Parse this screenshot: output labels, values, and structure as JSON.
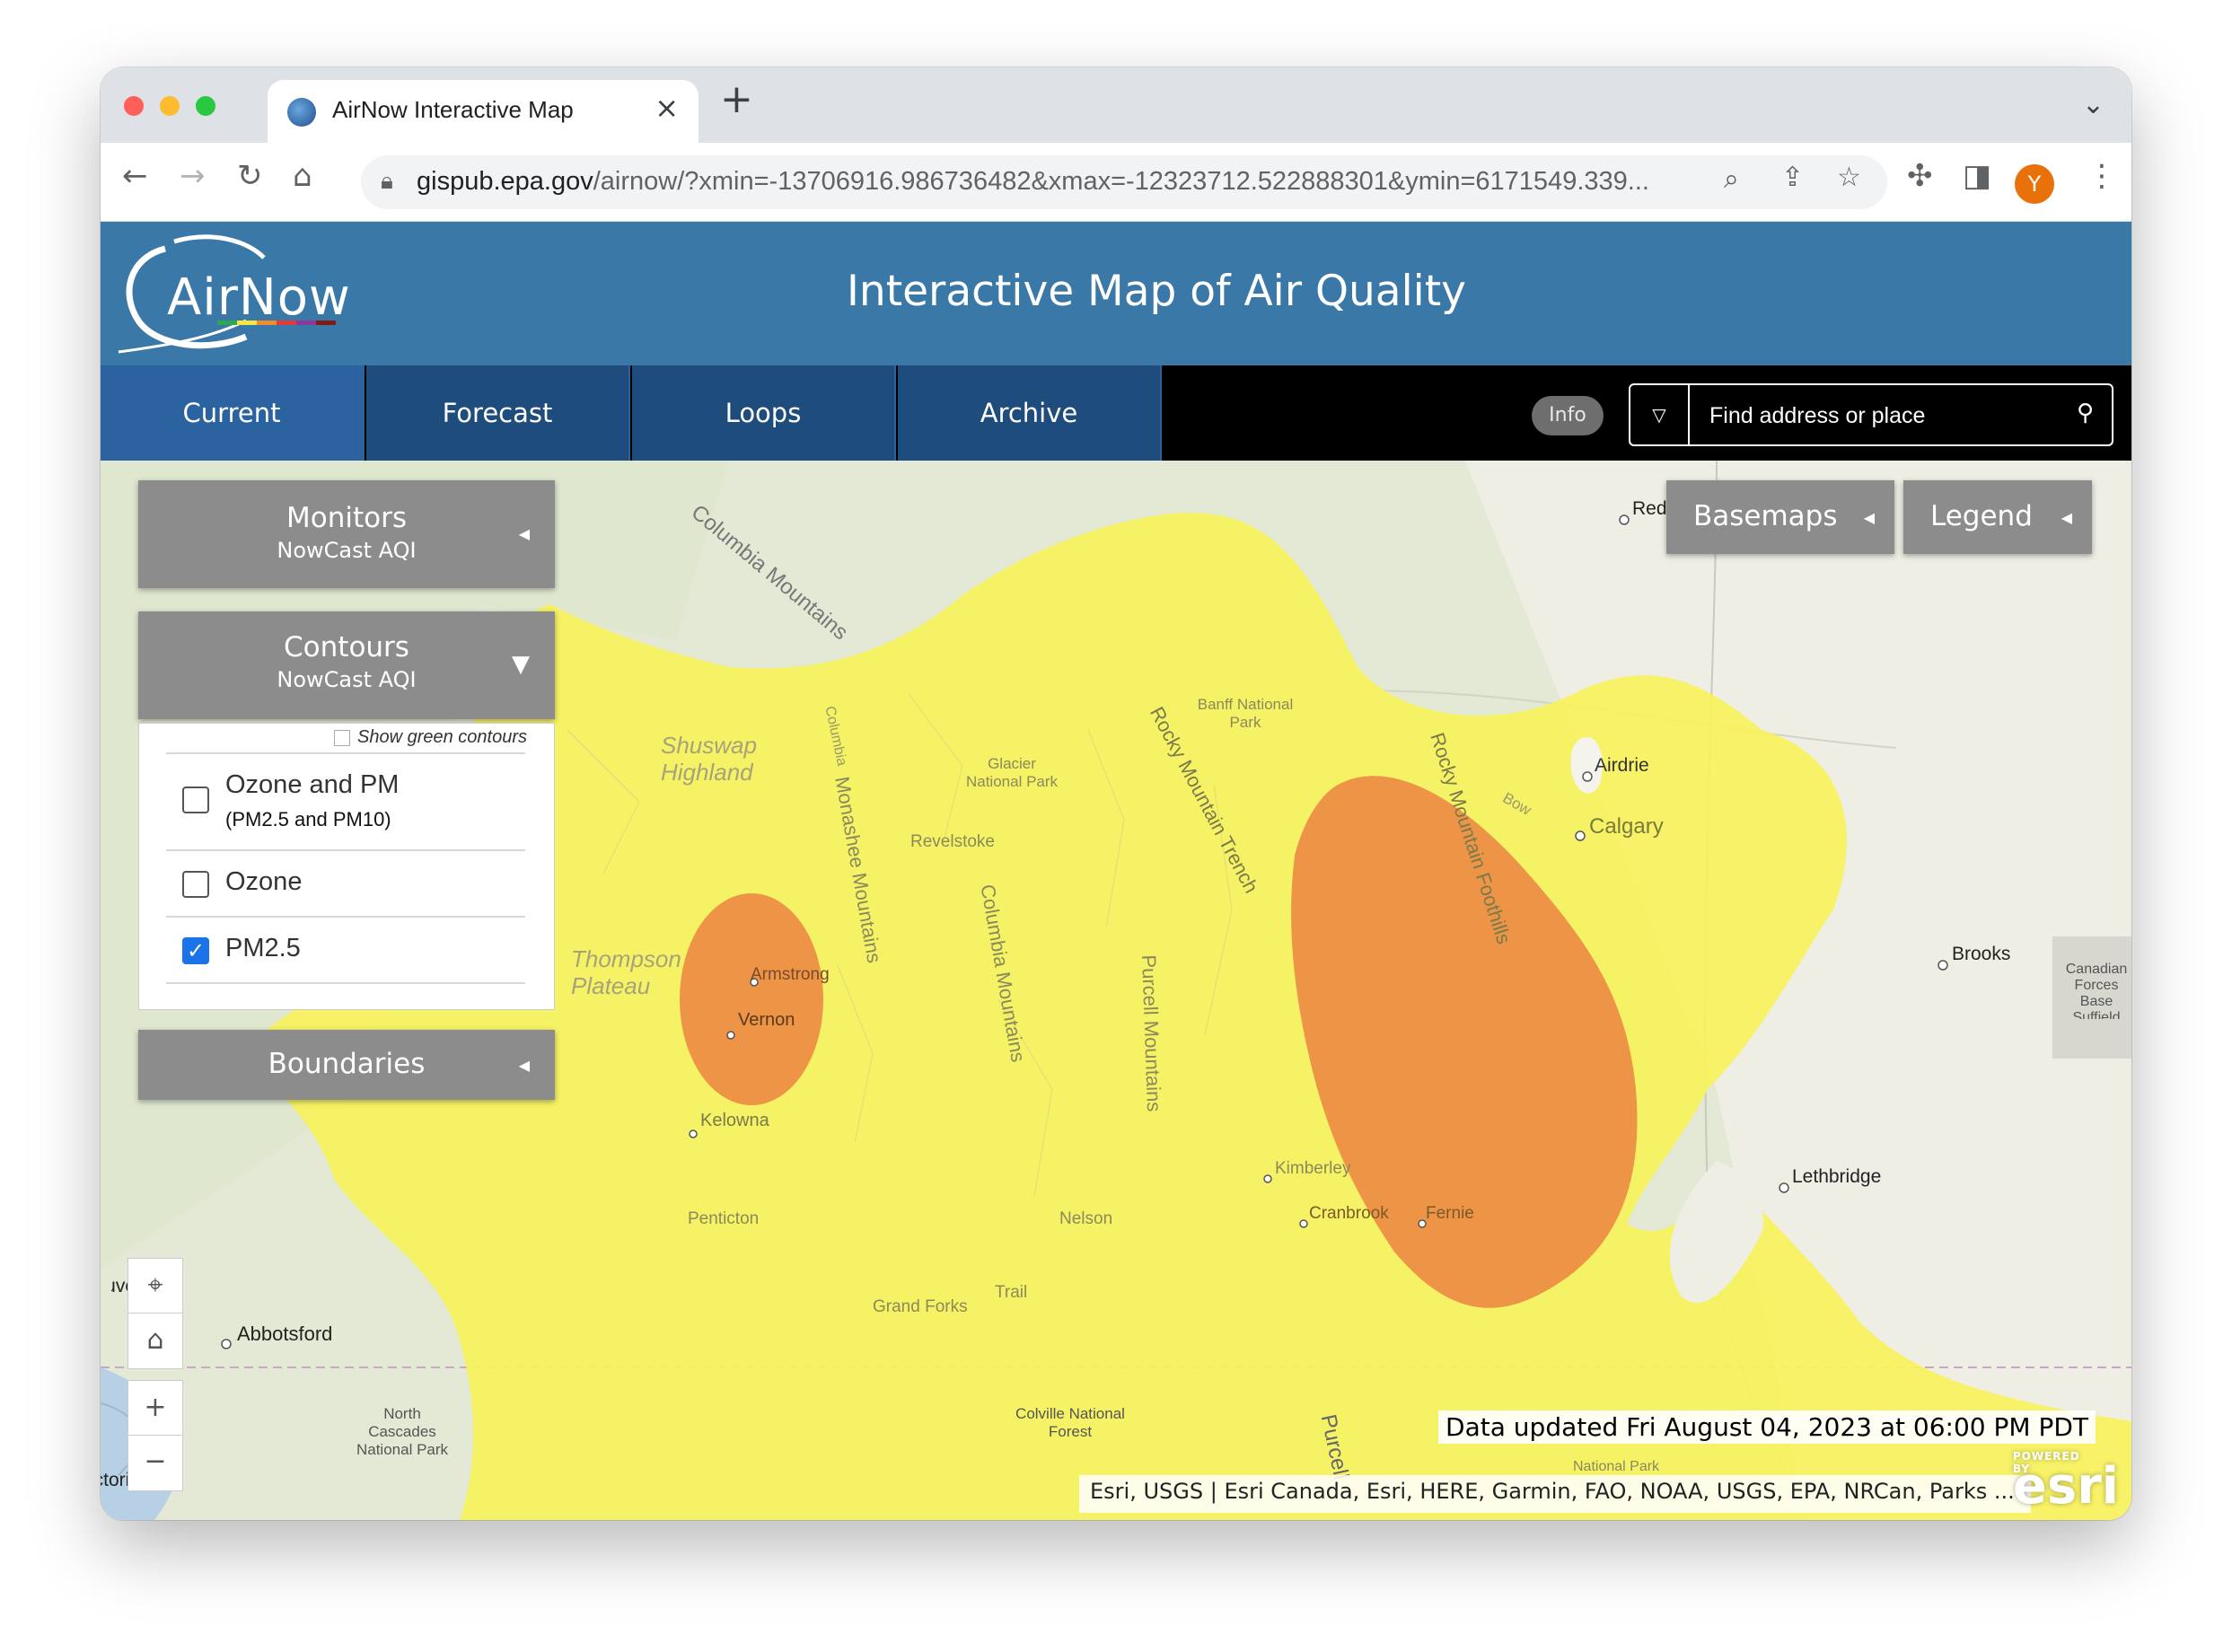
{
  "browser": {
    "tab_title": "AirNow Interactive Map",
    "url_host": "gispub.epa.gov",
    "url_rest": "/airnow/?xmin=-13706916.986736482&xmax=-12323712.522888301&ymin=6171549.339...",
    "avatar_initial": "Y"
  },
  "header": {
    "logo_text": "AirNow",
    "title": "Interactive Map of Air Quality"
  },
  "nav": {
    "tabs": [
      "Current",
      "Forecast",
      "Loops",
      "Archive"
    ],
    "info_label": "Info",
    "search_placeholder": "Find address or place"
  },
  "panels": {
    "monitors": {
      "title": "Monitors",
      "subtitle": "NowCast AQI"
    },
    "contours": {
      "title": "Contours",
      "subtitle": "NowCast AQI",
      "show_green_label": "Show green contours",
      "options": [
        {
          "label": "Ozone and PM",
          "sublabel": "(PM2.5 and PM10)",
          "checked": false
        },
        {
          "label": "Ozone",
          "checked": false
        },
        {
          "label": "PM2.5",
          "checked": true
        }
      ]
    },
    "boundaries": {
      "title": "Boundaries"
    },
    "basemaps": {
      "title": "Basemaps"
    },
    "legend": {
      "title": "Legend"
    }
  },
  "map": {
    "places": [
      "Red Deer",
      "Airdrie",
      "Calgary",
      "Brooks",
      "Lethbridge",
      "Revelstoke",
      "Armstrong",
      "Vernon",
      "Kelowna",
      "Penticton",
      "Nelson",
      "Trail",
      "Grand Forks",
      "Kimberley",
      "Cranbrook",
      "Fernie",
      "Abbotsford",
      "Vancouver",
      "Victoria"
    ],
    "features": [
      "Columbia Mountains",
      "Shuswap Highland",
      "Thompson Plateau",
      "Monashee Mountains",
      "Columbia Mountains",
      "Purcell Mountains",
      "Rocky Mountain Trench",
      "Rocky Mountain Foothills",
      "Banff National Park",
      "Glacier National Park",
      "North Cascades National Park",
      "Colville National Forest",
      "Purcell",
      "Bow",
      "Columbia",
      "Canadian Forces Base Suffield",
      "National Park"
    ],
    "updated_text": "Data updated Fri August 04, 2023 at 06:00 PM PDT",
    "attribution": "Esri, USGS | Esri Canada, Esri, HERE, Garmin, FAO, NOAA, USGS, EPA, NRCan, Parks ...",
    "esri_powered": "POWERED BY",
    "esri_logo": "esri",
    "colors": {
      "moderate": "#f7f25c",
      "usg": "#ec8e45",
      "unhealthy": "#e8423e",
      "terrain": "#e6ebd8"
    }
  }
}
